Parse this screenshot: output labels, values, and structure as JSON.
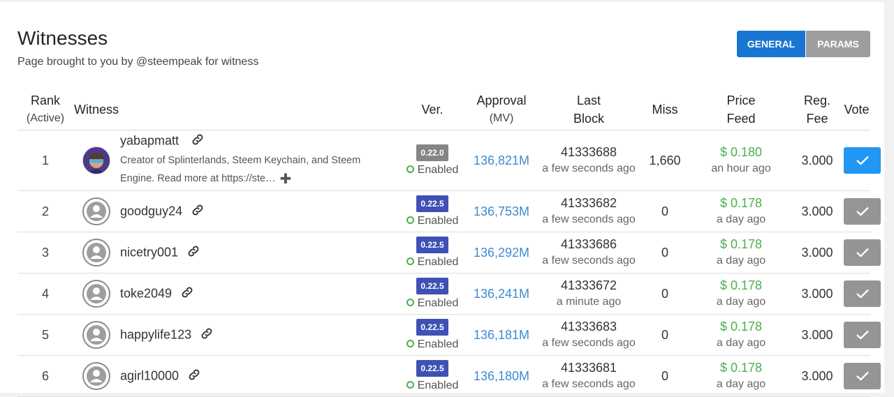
{
  "page": {
    "title": "Witnesses",
    "subtitle": "Page brought to you by @steempeak for witness"
  },
  "tabs": [
    {
      "label": "GENERAL",
      "active": true
    },
    {
      "label": "PARAMS",
      "active": false
    }
  ],
  "colors": {
    "primary": "#1976d2",
    "approval_link": "#3d8bd3",
    "price_green": "#4caf50",
    "version_current": "#3f51b5",
    "version_old": "#858585",
    "vote_active": "#2196f3",
    "vote_inactive": "#959595"
  },
  "columns": {
    "rank": "Rank",
    "rank_sub": "(Active)",
    "witness": "Witness",
    "ver": "Ver.",
    "approval": "Approval",
    "approval_sub": "(MV)",
    "last": "Last",
    "last_sub": "Block",
    "miss": "Miss",
    "price": "Price",
    "price_sub": "Feed",
    "reg": "Reg.",
    "reg_sub": "Fee",
    "vote": "Vote"
  },
  "rows": [
    {
      "rank": "1",
      "name": "yabapmatt",
      "avatar": "custom-avatar",
      "description": "Creator of Splinterlands, Steem Keychain, and Steem",
      "description_more": "Engine. Read more at https://ste…",
      "version": "0.22.0",
      "version_style": "old",
      "status": "Enabled",
      "approval": "136,821M",
      "last_block": "41333688",
      "last_block_time": "a few seconds ago",
      "miss": "1,660",
      "price": "$ 0.180",
      "price_time": "an hour ago",
      "reg_fee": "3.000",
      "voted": true
    },
    {
      "rank": "2",
      "name": "goodguy24",
      "avatar": "default-user-icon",
      "version": "0.22.5",
      "version_style": "current",
      "status": "Enabled",
      "approval": "136,753M",
      "last_block": "41333682",
      "last_block_time": "a few seconds ago",
      "miss": "0",
      "price": "$ 0.178",
      "price_time": "a day ago",
      "reg_fee": "3.000",
      "voted": false
    },
    {
      "rank": "3",
      "name": "nicetry001",
      "avatar": "default-user-icon",
      "version": "0.22.5",
      "version_style": "current",
      "status": "Enabled",
      "approval": "136,292M",
      "last_block": "41333686",
      "last_block_time": "a few seconds ago",
      "miss": "0",
      "price": "$ 0.178",
      "price_time": "a day ago",
      "reg_fee": "3.000",
      "voted": false
    },
    {
      "rank": "4",
      "name": "toke2049",
      "avatar": "default-user-icon",
      "version": "0.22.5",
      "version_style": "current",
      "status": "Enabled",
      "approval": "136,241M",
      "last_block": "41333672",
      "last_block_time": "a minute ago",
      "miss": "0",
      "price": "$ 0.178",
      "price_time": "a day ago",
      "reg_fee": "3.000",
      "voted": false
    },
    {
      "rank": "5",
      "name": "happylife123",
      "avatar": "default-user-icon",
      "version": "0.22.5",
      "version_style": "current",
      "status": "Enabled",
      "approval": "136,181M",
      "last_block": "41333683",
      "last_block_time": "a few seconds ago",
      "miss": "0",
      "price": "$ 0.178",
      "price_time": "a day ago",
      "reg_fee": "3.000",
      "voted": false
    },
    {
      "rank": "6",
      "name": "agirl10000",
      "avatar": "default-user-icon",
      "version": "0.22.5",
      "version_style": "current",
      "status": "Enabled",
      "approval": "136,180M",
      "last_block": "41333681",
      "last_block_time": "a few seconds ago",
      "miss": "0",
      "price": "$ 0.178",
      "price_time": "a day ago",
      "reg_fee": "3.000",
      "voted": false
    }
  ]
}
